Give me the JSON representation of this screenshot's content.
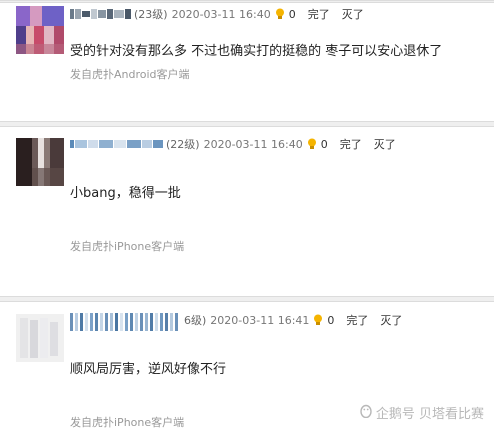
{
  "comments": [
    {
      "level": "(23级)",
      "time": "2020-03-11 16:40",
      "likes": "0",
      "action_good": "完了",
      "action_bad": "灭了",
      "content": "受的针对没有那么多 不过也确实打的挺稳的 枣子可以安心退休了",
      "source": "发自虎扑Android客户端"
    },
    {
      "level": "(22级)",
      "time": "2020-03-11 16:40",
      "likes": "0",
      "action_good": "完了",
      "action_bad": "灭了",
      "content": "小bang，稳得一批",
      "source": "发自虎扑iPhone客户端"
    },
    {
      "level": "6级)",
      "time": "2020-03-11 16:41",
      "likes": "0",
      "action_good": "完了",
      "action_bad": "灭了",
      "content": "顺风局厉害，逆风好像不行",
      "source": "发自虎扑iPhone客户端"
    }
  ],
  "watermark": {
    "text": "企鹅号 贝塔看比赛"
  },
  "colors": {
    "bulb": "#f5b400",
    "separator": "#efefef",
    "muted": "#999999"
  }
}
